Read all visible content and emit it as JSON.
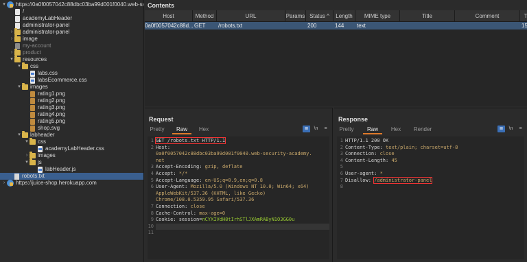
{
  "tree": {
    "items": [
      {
        "label": "https://0a0f0057042c88dbc03ba99d001f0040.web-security-academy.net",
        "icon": "globe-icon",
        "depth": 0,
        "twisty": "▾",
        "dim": false
      },
      {
        "label": "/",
        "icon": "file-icon",
        "depth": 1,
        "twisty": "",
        "dim": false
      },
      {
        "label": "academyLabHeader",
        "icon": "file-icon",
        "depth": 1,
        "twisty": "",
        "dim": false
      },
      {
        "label": "administrator-panel",
        "icon": "file-icon",
        "depth": 1,
        "twisty": "",
        "dim": false
      },
      {
        "label": "administrator-panel",
        "icon": "folder-icon",
        "depth": 1,
        "twisty": "›",
        "dim": false
      },
      {
        "label": "image",
        "icon": "folder-icon",
        "depth": 1,
        "twisty": "›",
        "dim": false
      },
      {
        "label": "my-account",
        "icon": "file-icon",
        "depth": 1,
        "twisty": "",
        "dim": true
      },
      {
        "label": "product",
        "icon": "folder-icon",
        "depth": 1,
        "twisty": "›",
        "dim": true
      },
      {
        "label": "resources",
        "icon": "folder-icon",
        "depth": 1,
        "twisty": "▾",
        "dim": false
      },
      {
        "label": "css",
        "icon": "folder-icon",
        "depth": 2,
        "twisty": "▾",
        "dim": false
      },
      {
        "label": "labs.css",
        "icon": "css-file-icon",
        "depth": 3,
        "twisty": "",
        "dim": false
      },
      {
        "label": "labsEcommerce.css",
        "icon": "css-file-icon",
        "depth": 3,
        "twisty": "",
        "dim": false
      },
      {
        "label": "images",
        "icon": "folder-icon",
        "depth": 2,
        "twisty": "▾",
        "dim": false
      },
      {
        "label": "rating1.png",
        "icon": "image-file-icon",
        "depth": 3,
        "twisty": "",
        "dim": false
      },
      {
        "label": "rating2.png",
        "icon": "image-file-icon",
        "depth": 3,
        "twisty": "",
        "dim": false
      },
      {
        "label": "rating3.png",
        "icon": "image-file-icon",
        "depth": 3,
        "twisty": "",
        "dim": false
      },
      {
        "label": "rating4.png",
        "icon": "image-file-icon",
        "depth": 3,
        "twisty": "",
        "dim": false
      },
      {
        "label": "rating5.png",
        "icon": "image-file-icon",
        "depth": 3,
        "twisty": "",
        "dim": false
      },
      {
        "label": "shop.svg",
        "icon": "image-file-icon",
        "depth": 3,
        "twisty": "",
        "dim": false
      },
      {
        "label": "labheader",
        "icon": "folder-icon",
        "depth": 2,
        "twisty": "▾",
        "dim": false
      },
      {
        "label": "css",
        "icon": "folder-icon",
        "depth": 3,
        "twisty": "▾",
        "dim": false
      },
      {
        "label": "academyLabHeader.css",
        "icon": "css-file-icon",
        "depth": 4,
        "twisty": "",
        "dim": false
      },
      {
        "label": "images",
        "icon": "folder-icon",
        "depth": 3,
        "twisty": "›",
        "dim": false
      },
      {
        "label": "js",
        "icon": "folder-icon",
        "depth": 3,
        "twisty": "▾",
        "dim": false
      },
      {
        "label": "labHeader.js",
        "icon": "js-file-icon",
        "depth": 4,
        "twisty": "",
        "dim": false
      },
      {
        "label": "robots.txt",
        "icon": "page-icon",
        "depth": 1,
        "twisty": "",
        "dim": false,
        "selected": true
      },
      {
        "label": "https://juice-shop.herokuapp.com",
        "icon": "globe-icon",
        "depth": 0,
        "twisty": "›",
        "dim": false
      }
    ]
  },
  "contents": {
    "title": "Contents",
    "columns": [
      "Host",
      "Method",
      "URL",
      "Params",
      "Status",
      "Length",
      "MIME type",
      "Title",
      "Comment",
      "Time"
    ],
    "sort_indicator": "^",
    "rows": [
      {
        "host": "0a0f0057042c88d...",
        "method": "GET",
        "url": "/robots.txt",
        "params": "",
        "status": "200",
        "length": "144",
        "mime": "text",
        "title": "",
        "comment": "",
        "time": "15"
      }
    ]
  },
  "request": {
    "title": "Request",
    "tabs": [
      "Pretty",
      "Raw",
      "Hex"
    ],
    "active_tab": "Raw",
    "tools": [
      "≣",
      "\\n",
      "≡"
    ],
    "lines": [
      {
        "n": "1",
        "key": "GET /robots.txt HTTP/1.1",
        "val": "",
        "highlight": true
      },
      {
        "n": "2",
        "key": "Host:",
        "val": "",
        "highlight": false
      },
      {
        "n": "",
        "key": "",
        "val": "0a0f0057042c88dbc03ba99d001f0040.web-security-academy.",
        "highlight": false
      },
      {
        "n": "",
        "key": "",
        "val": "net",
        "highlight": false
      },
      {
        "n": "3",
        "key": "Accept-Encoding: ",
        "val": "gzip, deflate",
        "highlight": false
      },
      {
        "n": "4",
        "key": "Accept: ",
        "val": "*/*",
        "highlight": false
      },
      {
        "n": "5",
        "key": "Accept-Language: ",
        "val": "en-US;q=0.9,en;q=0.8",
        "highlight": false
      },
      {
        "n": "6",
        "key": "User-Agent: ",
        "val": "Mozilla/5.0 (Windows NT 10.0; Win64; x64)",
        "highlight": false
      },
      {
        "n": "",
        "key": "",
        "val": "AppleWebKit/537.36 (KHTML, like Gecko)",
        "highlight": false
      },
      {
        "n": "",
        "key": "",
        "val": "Chrome/108.0.5359.95 Safari/537.36",
        "highlight": false
      },
      {
        "n": "7",
        "key": "Connection: ",
        "val": "close",
        "highlight": false
      },
      {
        "n": "8",
        "key": "Cache-Control: ",
        "val": "max-age=0",
        "highlight": false
      },
      {
        "n": "9",
        "key": "Cookie: session=",
        "val": "nCYXIVdH8tIrhSTlJXAmRAByN1O3GG0u",
        "highlight": false,
        "cookie": true
      },
      {
        "n": "10",
        "key": "",
        "val": "",
        "highlight": false
      },
      {
        "n": "11",
        "key": "",
        "val": "",
        "highlight": false
      }
    ]
  },
  "response": {
    "title": "Response",
    "tabs": [
      "Pretty",
      "Raw",
      "Hex",
      "Render"
    ],
    "active_tab": "Raw",
    "tools": [
      "≣",
      "\\n",
      "≡"
    ],
    "lines": [
      {
        "n": "1",
        "key": "HTTP/1.1 200 OK",
        "val": "",
        "highlight": false
      },
      {
        "n": "2",
        "key": "Content-Type: ",
        "val": "text/plain; charset=utf-8",
        "highlight": false
      },
      {
        "n": "3",
        "key": "Connection: ",
        "val": "close",
        "highlight": false
      },
      {
        "n": "4",
        "key": "Content-Length: ",
        "val": "45",
        "highlight": false
      },
      {
        "n": "5",
        "key": "",
        "val": "",
        "highlight": false
      },
      {
        "n": "6",
        "key": "User-agent: ",
        "val": "*",
        "highlight": false
      },
      {
        "n": "7",
        "key": "Disallow: ",
        "val": "/administrator-panel",
        "highlight": true
      },
      {
        "n": "8",
        "key": "",
        "val": "",
        "highlight": false
      }
    ]
  },
  "colors": {
    "accent": "#e07a2a",
    "selection": "#3b5675",
    "highlight_box": "#ee3333"
  }
}
